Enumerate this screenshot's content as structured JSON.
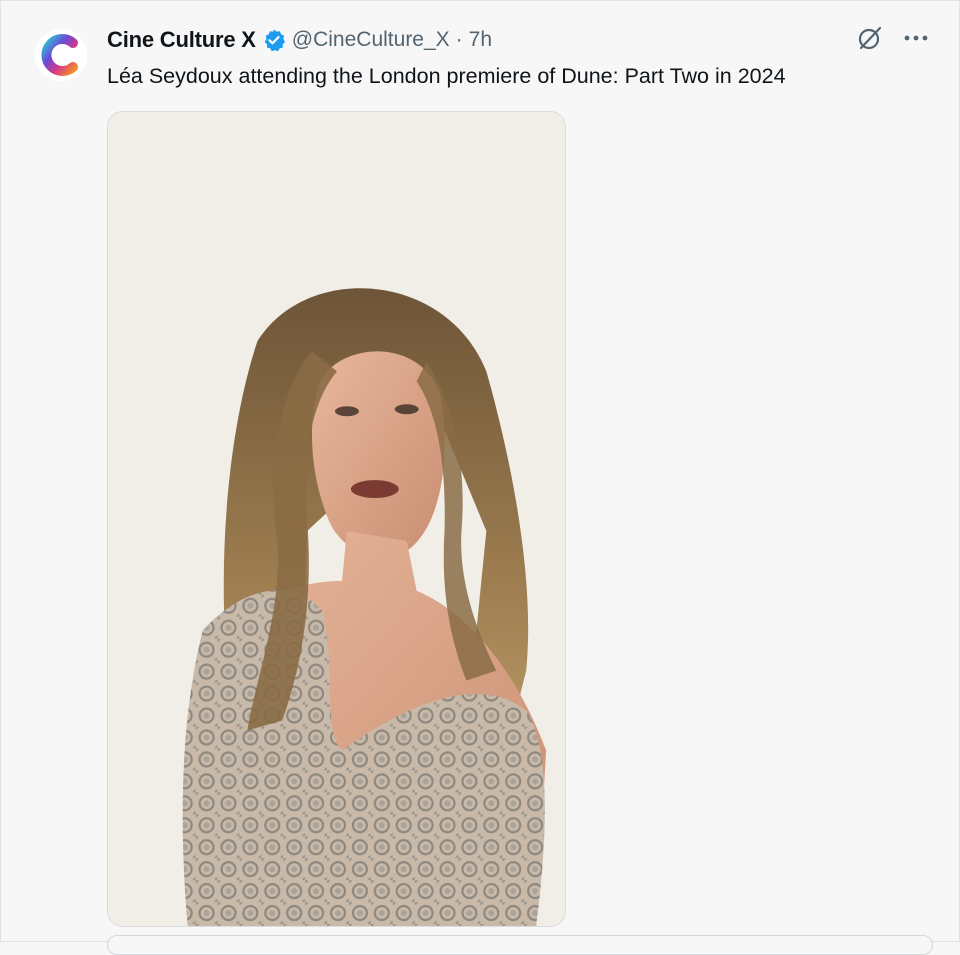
{
  "tweet": {
    "author": {
      "display_name": "Cine Culture X",
      "handle": "@CineCulture_X",
      "verified": true,
      "avatar_icon": "cine-culture-c-logo"
    },
    "separator": "·",
    "time": "7h",
    "text": "Léa Seydoux attending the London premiere of Dune: Part Two in 2024",
    "media": {
      "type": "photo"
    },
    "actions": {
      "grok_icon": "grok-icon",
      "more_icon": "more-options-icon"
    }
  },
  "colors": {
    "verified_blue": "#1d9bf0",
    "secondary_text": "#536471",
    "background": "#f7f7f7"
  }
}
